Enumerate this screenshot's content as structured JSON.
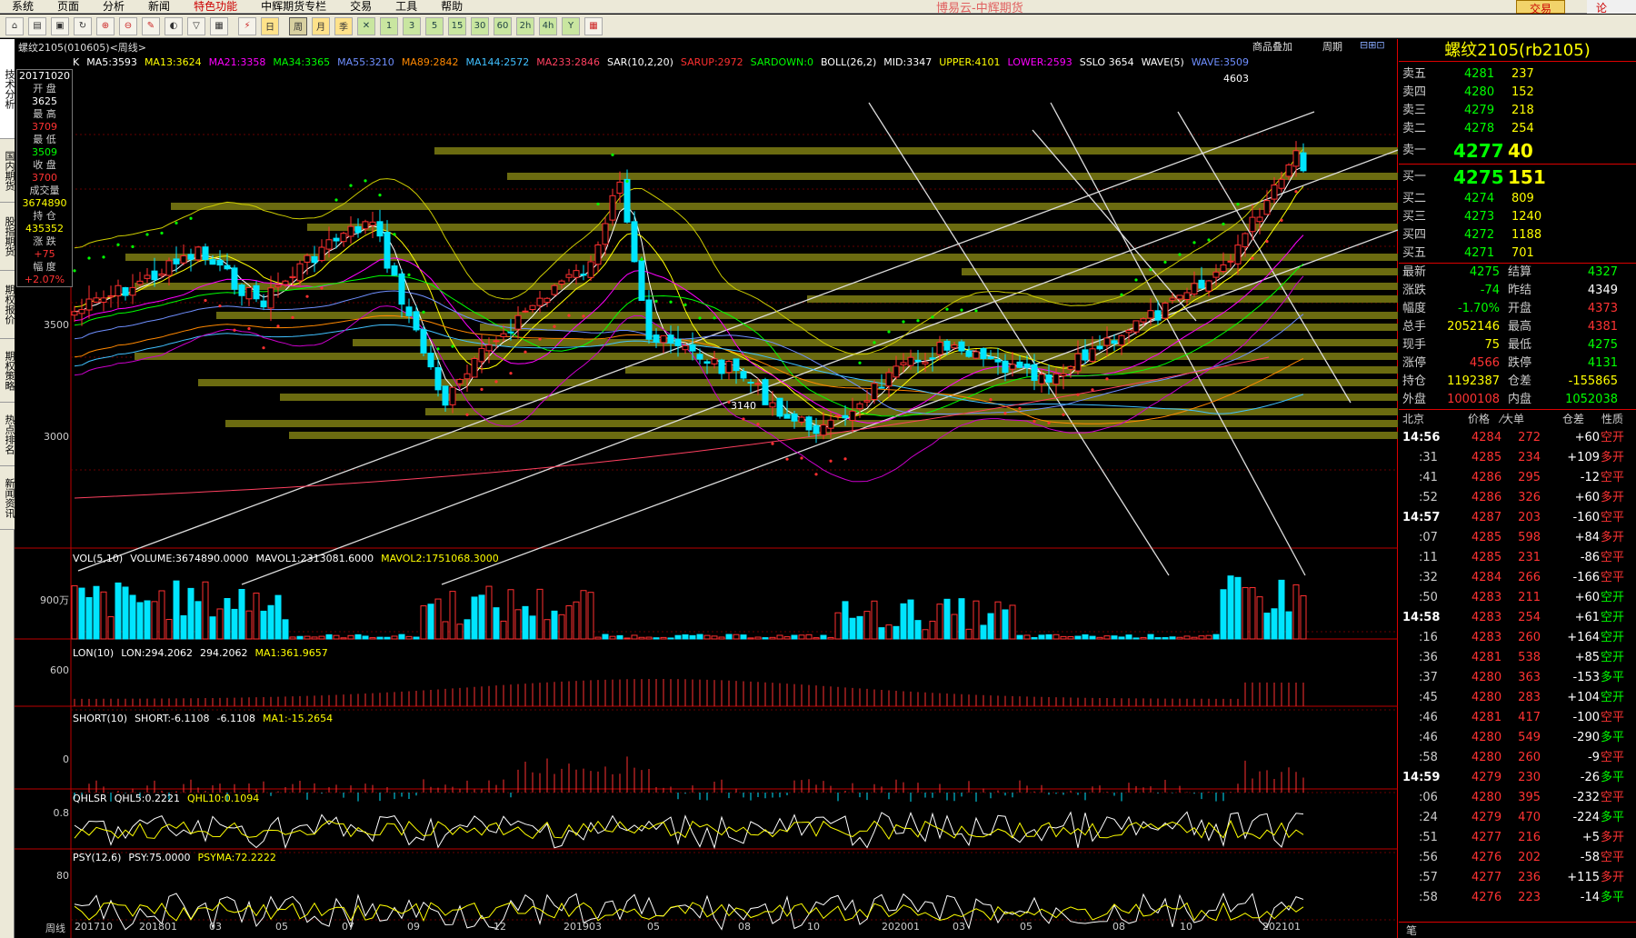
{
  "menu": {
    "items": [
      "系统",
      "页面",
      "分析",
      "新闻",
      "特色功能",
      "中辉期货专栏",
      "交易",
      "工具",
      "帮助"
    ],
    "brand": "博易云-中辉期货",
    "trade_button": "交易",
    "right_button": "论"
  },
  "toolbar": {
    "buttons": [
      "home",
      "open",
      "image",
      "refresh",
      "zoom-in",
      "zoom-out",
      "draw",
      "tool-a",
      "tool-b",
      "grid",
      "tick",
      "day",
      "week",
      "month",
      "quarter",
      "x",
      "1",
      "3",
      "5",
      "15",
      "30",
      "60",
      "2h",
      "4h",
      "Y",
      "calc"
    ]
  },
  "sidebar": {
    "tabs": [
      "技术分析",
      "国内期货",
      "股指期货",
      "期权报价",
      "期权策略",
      "热点排名",
      "新闻资讯"
    ]
  },
  "chart": {
    "title": "螺纹2105(010605)<周线>",
    "links": [
      "商品叠加",
      "周期"
    ],
    "ma_legend": [
      {
        "text": "K",
        "color": "#ffffff"
      },
      {
        "text": "MA5:3593",
        "color": "#ffffff"
      },
      {
        "text": "MA13:3624",
        "color": "#ffff00"
      },
      {
        "text": "MA21:3358",
        "color": "#ff00ff"
      },
      {
        "text": "MA34:3365",
        "color": "#00ff00"
      },
      {
        "text": "MA55:3210",
        "color": "#6f8fff"
      },
      {
        "text": "MA89:2842",
        "color": "#ff8800"
      },
      {
        "text": "MA144:2572",
        "color": "#40c0ff"
      },
      {
        "text": "MA233:2846",
        "color": "#ff4060"
      },
      {
        "text": "SAR(10,2,20)",
        "color": "#ffffff"
      },
      {
        "text": "SARUP:2972",
        "color": "#ff3030"
      },
      {
        "text": "SARDOWN:0",
        "color": "#00ff00"
      },
      {
        "text": "BOLL(26,2)",
        "color": "#ffffff"
      },
      {
        "text": "MID:3347",
        "color": "#ffffff"
      },
      {
        "text": "UPPER:4101",
        "color": "#ffff00"
      },
      {
        "text": "LOWER:2593",
        "color": "#ff00ff"
      },
      {
        "text": "SSLO 3654",
        "color": "#ffffff"
      },
      {
        "text": "WAVE(5)",
        "color": "#ffffff"
      },
      {
        "text": "WAVE:3509",
        "color": "#6f8fff"
      }
    ],
    "info": {
      "date": "20171020",
      "open_label": "开 盘",
      "open": "3625",
      "high_label": "最 高",
      "high": "3709",
      "low_label": "最 低",
      "low": "3509",
      "close_label": "收 盘",
      "close": "3700",
      "vol_label": "成交量",
      "vol": "3674890",
      "oi_label": "持 仓",
      "oi": "435352",
      "chg_label": "涨 跌",
      "chg": "+75",
      "pct_label": "幅 度",
      "pct": "+2.07%"
    },
    "price_axis": [
      "3500",
      "3000"
    ],
    "annot_high": "4603",
    "annot_low": "3140",
    "vol_legend": [
      {
        "text": "VOL(5,10)",
        "color": "#ffffff"
      },
      {
        "text": "VOLUME:3674890.0000",
        "color": "#ffffff"
      },
      {
        "text": "MAVOL1:2313081.6000",
        "color": "#ffffff"
      },
      {
        "text": "MAVOL2:1751068.3000",
        "color": "#ffff00"
      }
    ],
    "vol_axis": "900万",
    "lon_legend": [
      {
        "text": "LON(10)",
        "color": "#ffffff"
      },
      {
        "text": "LON:294.2062",
        "color": "#ffffff"
      },
      {
        "text": "294.2062",
        "color": "#ffffff"
      },
      {
        "text": "MA1:361.9657",
        "color": "#ffff00"
      }
    ],
    "lon_axis": "600",
    "short_legend": [
      {
        "text": "SHORT(10)",
        "color": "#ffffff"
      },
      {
        "text": "SHORT:-6.1108",
        "color": "#ffffff"
      },
      {
        "text": "-6.1108",
        "color": "#ffffff"
      },
      {
        "text": "MA1:-15.2654",
        "color": "#ffff00"
      }
    ],
    "short_axis": "0",
    "qhlsr_legend": [
      {
        "text": "QHLSR",
        "color": "#ffffff"
      },
      {
        "text": "QHL5:0.2221",
        "color": "#ffffff"
      },
      {
        "text": "QHL10:0.1094",
        "color": "#ffff00"
      }
    ],
    "qhlsr_axis": "0.8",
    "psy_legend": [
      {
        "text": "PSY(12,6)",
        "color": "#ffffff"
      },
      {
        "text": "PSY:75.0000",
        "color": "#ffffff"
      },
      {
        "text": "PSYMA:72.2222",
        "color": "#ffff00"
      }
    ],
    "psy_axis": "80",
    "period_label": "周线",
    "x_labels": [
      "201710",
      "201801",
      "03",
      "05",
      "07",
      "09",
      "12",
      "201903",
      "05",
      "08",
      "10",
      "202001",
      "03",
      "05",
      "08",
      "10",
      "202101"
    ]
  },
  "quote": {
    "title": "螺纹2105(rb2105)",
    "asks": [
      {
        "label": "卖五",
        "price": "4281",
        "vol": "237"
      },
      {
        "label": "卖四",
        "price": "4280",
        "vol": "152"
      },
      {
        "label": "卖三",
        "price": "4279",
        "vol": "218"
      },
      {
        "label": "卖二",
        "price": "4278",
        "vol": "254"
      },
      {
        "label": "卖一",
        "price": "4277",
        "vol": "40"
      }
    ],
    "bids": [
      {
        "label": "买一",
        "price": "4275",
        "vol": "151"
      },
      {
        "label": "买二",
        "price": "4274",
        "vol": "809"
      },
      {
        "label": "买三",
        "price": "4273",
        "vol": "1240"
      },
      {
        "label": "买四",
        "price": "4272",
        "vol": "1188"
      },
      {
        "label": "买五",
        "price": "4271",
        "vol": "701"
      }
    ],
    "stats": [
      {
        "l1": "最新",
        "v1": "4275",
        "c1": "grn",
        "l2": "结算",
        "v2": "4327",
        "c2": "grn"
      },
      {
        "l1": "涨跌",
        "v1": "-74",
        "c1": "grn",
        "l2": "昨结",
        "v2": "4349",
        "c2": "wht"
      },
      {
        "l1": "幅度",
        "v1": "-1.70%",
        "c1": "grn",
        "l2": "开盘",
        "v2": "4373",
        "c2": "red"
      },
      {
        "l1": "总手",
        "v1": "2052146",
        "c1": "yel",
        "l2": "最高",
        "v2": "4381",
        "c2": "red"
      },
      {
        "l1": "现手",
        "v1": "75",
        "c1": "yel",
        "l2": "最低",
        "v2": "4275",
        "c2": "grn"
      },
      {
        "l1": "涨停",
        "v1": "4566",
        "c1": "red",
        "l2": "跌停",
        "v2": "4131",
        "c2": "grn"
      },
      {
        "l1": "持仓",
        "v1": "1192387",
        "c1": "yel",
        "l2": "仓差",
        "v2": "-155865",
        "c2": "yel"
      },
      {
        "l1": "外盘",
        "v1": "1000108",
        "c1": "red",
        "l2": "内盘",
        "v2": "1052038",
        "c2": "grn"
      }
    ],
    "tick_header": {
      "time": "北京",
      "price": "价格",
      "vol": "⁄大单",
      "oi": "仓差",
      "nature": "性质"
    },
    "ticks": [
      {
        "t": "14:56",
        "p": "4284",
        "v": "272",
        "oi": "+60",
        "n": "空开",
        "nc": "red"
      },
      {
        "t": ":31",
        "p": "4285",
        "v": "234",
        "oi": "+109",
        "n": "多开",
        "nc": "red"
      },
      {
        "t": ":41",
        "p": "4286",
        "v": "295",
        "oi": "-12",
        "n": "空平",
        "nc": "red"
      },
      {
        "t": ":52",
        "p": "4286",
        "v": "326",
        "oi": "+60",
        "n": "多开",
        "nc": "red"
      },
      {
        "t": "14:57",
        "p": "4287",
        "v": "203",
        "oi": "-160",
        "n": "空平",
        "nc": "red"
      },
      {
        "t": ":07",
        "p": "4285",
        "v": "598",
        "oi": "+84",
        "n": "多开",
        "nc": "red"
      },
      {
        "t": ":11",
        "p": "4285",
        "v": "231",
        "oi": "-86",
        "n": "空平",
        "nc": "red"
      },
      {
        "t": ":32",
        "p": "4284",
        "v": "266",
        "oi": "-166",
        "n": "空平",
        "nc": "red"
      },
      {
        "t": ":50",
        "p": "4283",
        "v": "211",
        "oi": "+60",
        "n": "空开",
        "nc": "grn"
      },
      {
        "t": "14:58",
        "p": "4283",
        "v": "254",
        "oi": "+61",
        "n": "空开",
        "nc": "grn"
      },
      {
        "t": ":16",
        "p": "4283",
        "v": "260",
        "oi": "+164",
        "n": "空开",
        "nc": "grn"
      },
      {
        "t": ":36",
        "p": "4281",
        "v": "538",
        "oi": "+85",
        "n": "空开",
        "nc": "grn"
      },
      {
        "t": ":37",
        "p": "4280",
        "v": "363",
        "oi": "-153",
        "n": "多平",
        "nc": "grn"
      },
      {
        "t": ":45",
        "p": "4280",
        "v": "283",
        "oi": "+104",
        "n": "空开",
        "nc": "grn"
      },
      {
        "t": ":46",
        "p": "4281",
        "v": "417",
        "oi": "-100",
        "n": "空平",
        "nc": "red"
      },
      {
        "t": ":46",
        "p": "4280",
        "v": "549",
        "oi": "-290",
        "n": "多平",
        "nc": "grn"
      },
      {
        "t": ":58",
        "p": "4280",
        "v": "260",
        "oi": "-9",
        "n": "空平",
        "nc": "red"
      },
      {
        "t": "14:59",
        "p": "4279",
        "v": "230",
        "oi": "-26",
        "n": "多平",
        "nc": "grn"
      },
      {
        "t": ":06",
        "p": "4280",
        "v": "395",
        "oi": "-232",
        "n": "空平",
        "nc": "red"
      },
      {
        "t": ":24",
        "p": "4279",
        "v": "470",
        "oi": "-224",
        "n": "多平",
        "nc": "grn"
      },
      {
        "t": ":51",
        "p": "4277",
        "v": "216",
        "oi": "+5",
        "n": "多开",
        "nc": "red"
      },
      {
        "t": ":56",
        "p": "4276",
        "v": "202",
        "oi": "-58",
        "n": "空平",
        "nc": "red"
      },
      {
        "t": ":57",
        "p": "4277",
        "v": "236",
        "oi": "+115",
        "n": "多开",
        "nc": "red"
      },
      {
        "t": ":58",
        "p": "4276",
        "v": "223",
        "oi": "-14",
        "n": "多平",
        "nc": "grn"
      }
    ],
    "bottom_tab": "笔"
  }
}
